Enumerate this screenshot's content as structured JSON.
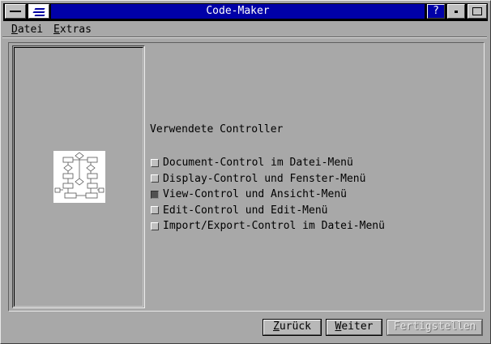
{
  "window": {
    "title": "Code-Maker",
    "help_label": "?"
  },
  "menu": {
    "items": [
      {
        "label": "Datei",
        "mnemonic": "D",
        "rest": "atei"
      },
      {
        "label": "Extras",
        "mnemonic": "E",
        "rest": "xtras"
      }
    ]
  },
  "content": {
    "heading": "Verwendete Controller",
    "controllers": [
      {
        "label": "Document-Control im Datei-Menü",
        "checked": false
      },
      {
        "label": "Display-Control und Fenster-Menü",
        "checked": false
      },
      {
        "label": "View-Control und Ansicht-Menü",
        "checked": true
      },
      {
        "label": "Edit-Control und Edit-Menü",
        "checked": false
      },
      {
        "label": "Import/Export-Control im Datei-Menü",
        "checked": false
      }
    ]
  },
  "buttons": {
    "back": {
      "label": "Zurück",
      "mnemonic": "Z",
      "rest": "urück"
    },
    "next": {
      "label": "Weiter",
      "mnemonic": "W",
      "rest": "eiter"
    },
    "finish": {
      "label": "Fertigstellen",
      "enabled": false
    }
  },
  "colors": {
    "face": "#a8a8a8",
    "title_active": "#0000a8",
    "title_text": "#ffffff",
    "bullet_active": "#505050"
  }
}
